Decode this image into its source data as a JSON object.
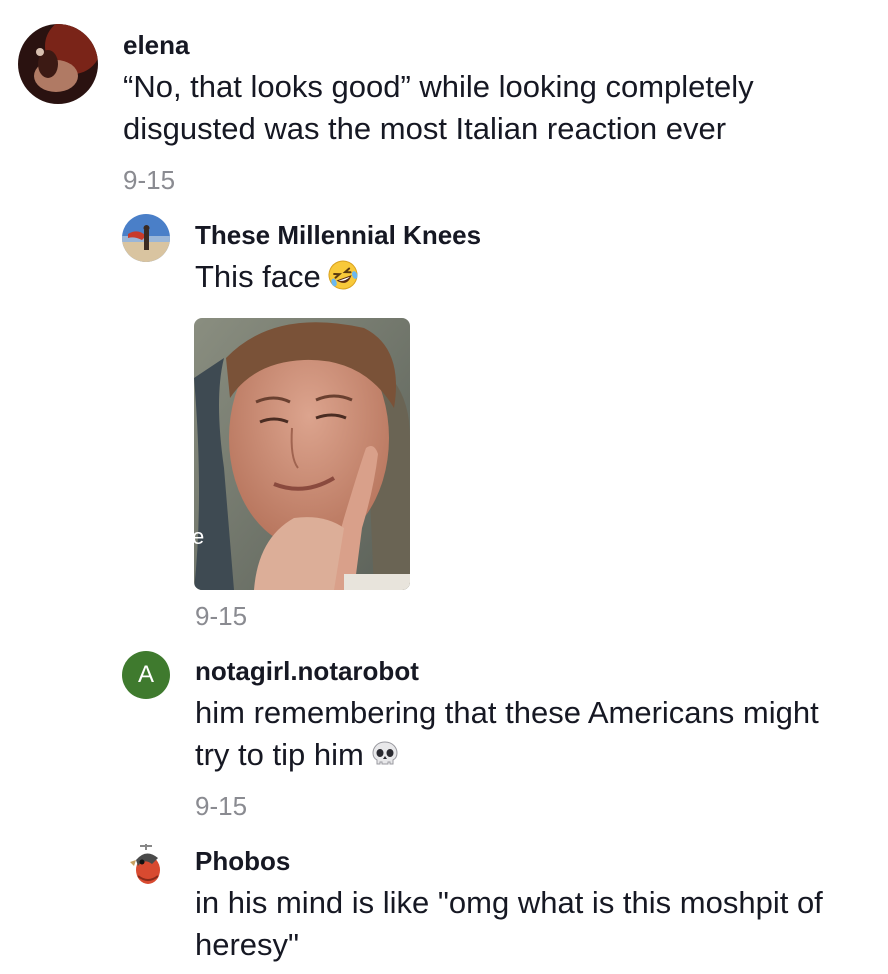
{
  "comments": [
    {
      "username": "elena",
      "text_line1": "“No, that looks good” while looking completely",
      "text_line2": "disgusted was the most Italian reaction ever",
      "date": "9-15",
      "avatar": "photo-avatar-dark"
    },
    {
      "username": "These Millennial Knees",
      "text": "This face",
      "emoji": "rolling-on-floor-laughing-emoji",
      "date": "9-15",
      "avatar": "photo-avatar-beach",
      "image": "reaction-photo-smirking-man"
    },
    {
      "username": "notagirl.notarobot",
      "avatar_letter": "A",
      "avatar_color": "#3f7a2e",
      "text_line1": "him remembering that these Americans might",
      "text_line2": "try to tip him",
      "emoji": "skull-emoji",
      "date": "9-15"
    },
    {
      "username": "Phobos",
      "text_line1": "in his mind is like \"omg what is this moshpit of",
      "text_line2": "heresy\"",
      "avatar": "photo-avatar-bird"
    }
  ],
  "colors": {
    "username": "#161823",
    "text": "#161823",
    "date": "#8a8b91"
  }
}
